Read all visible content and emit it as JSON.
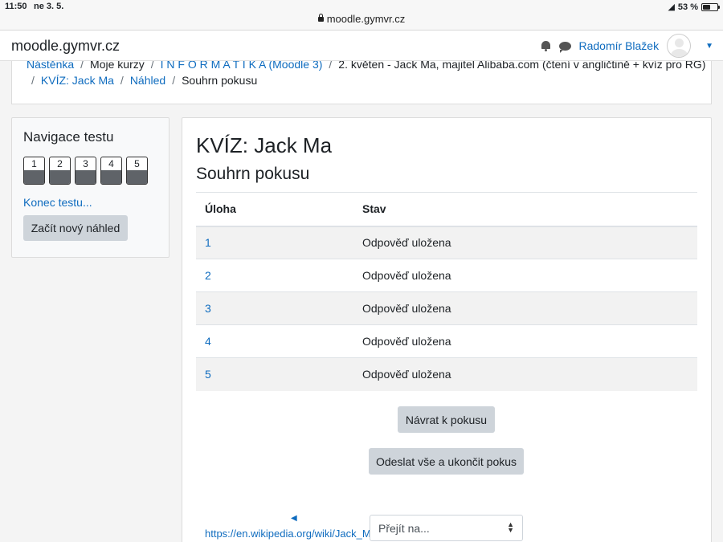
{
  "status_bar": {
    "time": "11:50",
    "date": "ne 3. 5.",
    "url": "moodle.gymvr.cz",
    "battery": "53 %",
    "battery_level": 0.53
  },
  "navbar": {
    "brand": "moodle.gymvr.cz",
    "user_name": "Radomír Blažek"
  },
  "breadcrumb": {
    "line1": [
      "Nástěnka",
      "Moje kurzy",
      "I N F O R M A T I K A (Moodle 3)",
      "2. květen - Jack Ma, majitel Alibaba.com (čtení v angličtině + kvíz pro RG)"
    ],
    "line2": [
      "KVÍZ: Jack Ma",
      "Náhled",
      "Souhrn pokusu"
    ]
  },
  "quiz_nav": {
    "title": "Navigace testu",
    "questions": [
      "1",
      "2",
      "3",
      "4",
      "5"
    ],
    "end_link": "Konec testu...",
    "new_preview_button": "Začít nový náhled"
  },
  "main": {
    "title": "KVÍZ: Jack Ma",
    "subtitle": "Souhrn pokusu",
    "table": {
      "headers": [
        "Úloha",
        "Stav"
      ],
      "rows": [
        [
          "1",
          "Odpověď uložena"
        ],
        [
          "2",
          "Odpověď uložena"
        ],
        [
          "3",
          "Odpověď uložena"
        ],
        [
          "4",
          "Odpověď uložena"
        ],
        [
          "5",
          "Odpověď uložena"
        ]
      ]
    },
    "return_button": "Návrat k pokusu",
    "submit_button": "Odeslat vše a ukončit pokus",
    "prev_activity_link": "https://en.wikipedia.org/wiki/Jack_Ma",
    "jump_select": "Přejít na..."
  }
}
